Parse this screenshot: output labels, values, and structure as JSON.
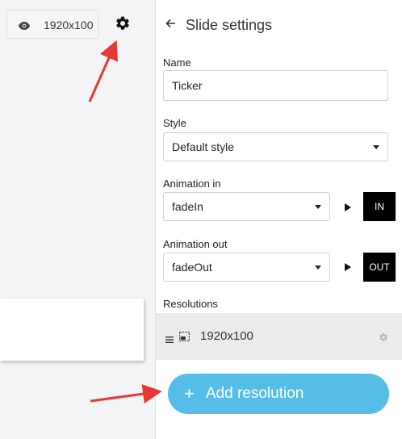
{
  "toolbar": {
    "resolution_label": "1920x100",
    "preview_icon": "eye-icon",
    "settings_icon": "gear-icon"
  },
  "panel": {
    "back_icon": "arrow-left-icon",
    "title": "Slide settings",
    "name_label": "Name",
    "name_value": "Ticker",
    "style_label": "Style",
    "style_value": "Default style",
    "animation_in_label": "Animation in",
    "animation_in_value": "fadeIn",
    "animation_in_button": "IN",
    "animation_out_label": "Animation out",
    "animation_out_value": "fadeOut",
    "animation_out_button": "OUT",
    "resolutions_label": "Resolutions",
    "resolutions": [
      {
        "label": "1920x100"
      }
    ],
    "add_resolution_label": "Add resolution"
  },
  "colors": {
    "accent": "#55bde8",
    "annotation_arrow": "#e53935",
    "button_dark": "#000000"
  }
}
